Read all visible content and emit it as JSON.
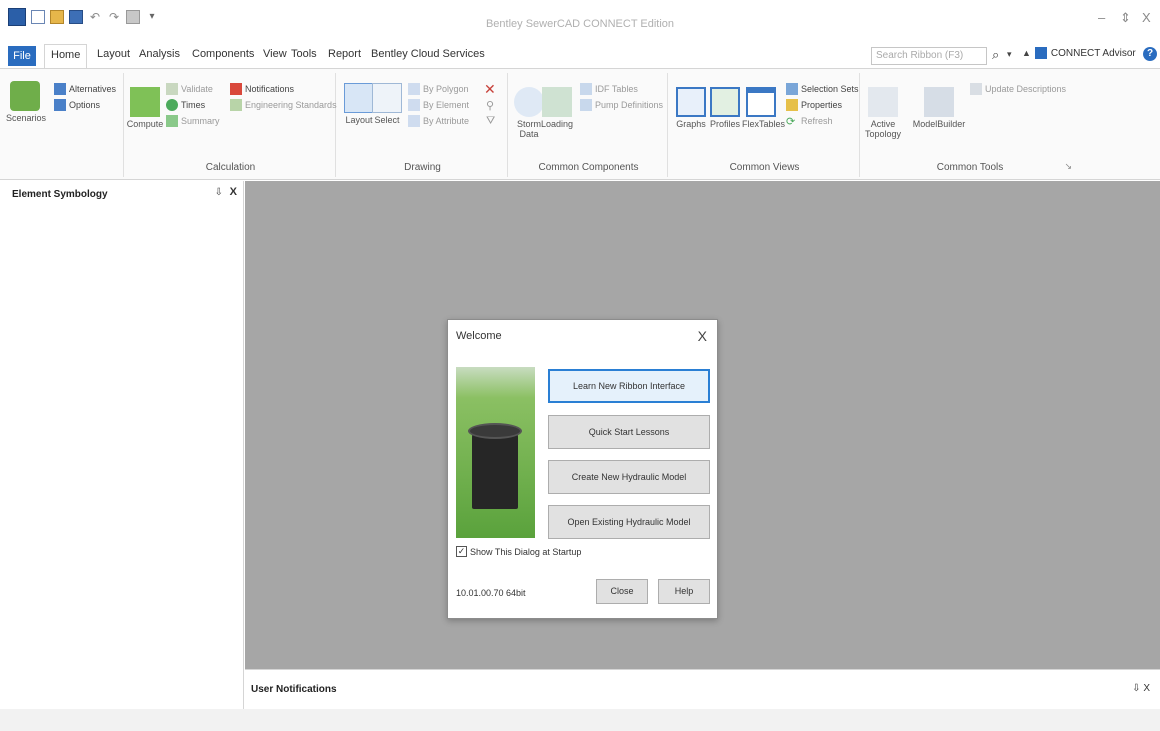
{
  "window": {
    "title": "Bentley SewerCAD CONNECT Edition",
    "minimize": "–",
    "maximize": "⇕",
    "close": "X"
  },
  "tabs": [
    "File",
    "Home",
    "Layout",
    "Analysis",
    "Components",
    "View",
    "Tools",
    "Report",
    "Bentley Cloud Services"
  ],
  "search": {
    "placeholder": "Search Ribbon (F3)"
  },
  "connect_advisor": "CONNECT Advisor",
  "ribbon": {
    "scenarios": {
      "label": "Scenarios",
      "alternatives": "Alternatives",
      "options": "Options"
    },
    "calculation": {
      "group": "Calculation",
      "compute": "Compute",
      "validate": "Validate",
      "times": "Times",
      "summary": "Summary",
      "notifications": "Notifications",
      "engineering_standards": "Engineering Standards"
    },
    "drawing": {
      "group": "Drawing",
      "layout": "Layout",
      "select": "Select",
      "by_polygon": "By Polygon",
      "by_element": "By Element",
      "by_attribute": "By Attribute"
    },
    "common_components": {
      "group": "Common Components",
      "storm_data": "Storm Data",
      "loading": "Loading",
      "idf_tables": "IDF Tables",
      "pump_definitions": "Pump Definitions"
    },
    "common_views": {
      "group": "Common Views",
      "graphs": "Graphs",
      "profiles": "Profiles",
      "flextables": "FlexTables",
      "selection_sets": "Selection Sets",
      "properties": "Properties",
      "refresh": "Refresh"
    },
    "common_tools": {
      "group": "Common Tools",
      "active_topology": "Active Topology",
      "model_builder": "ModelBuilder",
      "update_descriptions": "Update Descriptions"
    }
  },
  "left_panel": {
    "title": "Element Symbology",
    "pin": "⇩",
    "close": "X"
  },
  "bottom_panel": {
    "title": "User Notifications",
    "controls": "⇩ X"
  },
  "dialog": {
    "title": "Welcome",
    "close": "X",
    "buttons": [
      "Learn New Ribbon Interface",
      "Quick Start Lessons",
      "Create New Hydraulic Model",
      "Open Existing Hydraulic Model"
    ],
    "show_dialog_label": "Show This Dialog at Startup",
    "show_dialog_checked": true,
    "version": "10.01.00.70 64bit",
    "close_label": "Close",
    "help_label": "Help"
  }
}
